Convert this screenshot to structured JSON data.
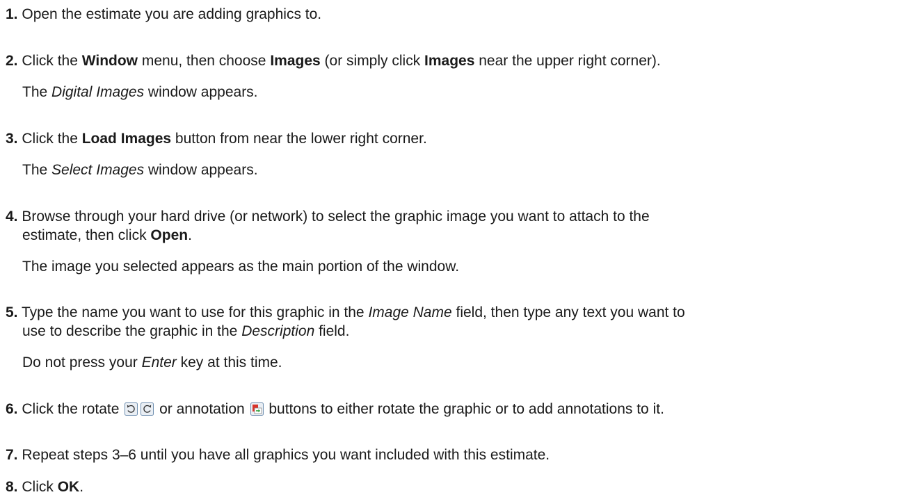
{
  "steps": [
    {
      "number": "1.",
      "text": "Open the estimate you are adding graphics to."
    },
    {
      "number": "2.",
      "part1": "Click the ",
      "bold1": "Window",
      "part2": " menu, then choose ",
      "bold2": "Images",
      "part3": " (or simply click ",
      "bold3": "Images",
      "part4": " near the upper right corner).",
      "result_part1": "The ",
      "result_italic": "Digital Images",
      "result_part2": " window appears."
    },
    {
      "number": "3.",
      "part1": "Click the ",
      "bold1": "Load Images",
      "part2": " button from near the lower right corner.",
      "result_part1": "The ",
      "result_italic": "Select Images",
      "result_part2": " window appears."
    },
    {
      "number": "4.",
      "line1": "Browse through your hard drive (or network) to select the graphic image you want to attach to the",
      "line2_part1": "estimate, then click ",
      "line2_bold": "Open",
      "line2_part2": ".",
      "result": "The image you selected appears as the main portion of the window."
    },
    {
      "number": "5.",
      "line1_part1": "Type the name you want to use for this graphic in the ",
      "line1_italic": "Image Name",
      "line1_part2": " field, then type any text you want to",
      "line2_part1": "use to describe the graphic in the ",
      "line2_italic": "Description",
      "line2_part2": " field.",
      "result_part1": "Do not press your ",
      "result_italic": "Enter",
      "result_part2": " key at this time."
    },
    {
      "number": "6.",
      "part1": "Click the rotate ",
      "part2": " or annotation ",
      "part3": " buttons to either rotate the graphic or to add annotations to it.",
      "icons": [
        "rotate-left-icon",
        "rotate-right-icon",
        "annotation-icon"
      ]
    },
    {
      "number": "7.",
      "text": "Repeat steps 3–6 until you have all graphics you want included with this estimate."
    },
    {
      "number": "8.",
      "part1": "Click ",
      "bold1": "OK",
      "part2": "."
    }
  ],
  "colors": {
    "text": "#1a1a1a",
    "icon_border": "#6f8fb0",
    "icon_fill": "#e9eef4",
    "annotation_red": "#d9342b",
    "annotation_green": "#2f9e3a"
  }
}
